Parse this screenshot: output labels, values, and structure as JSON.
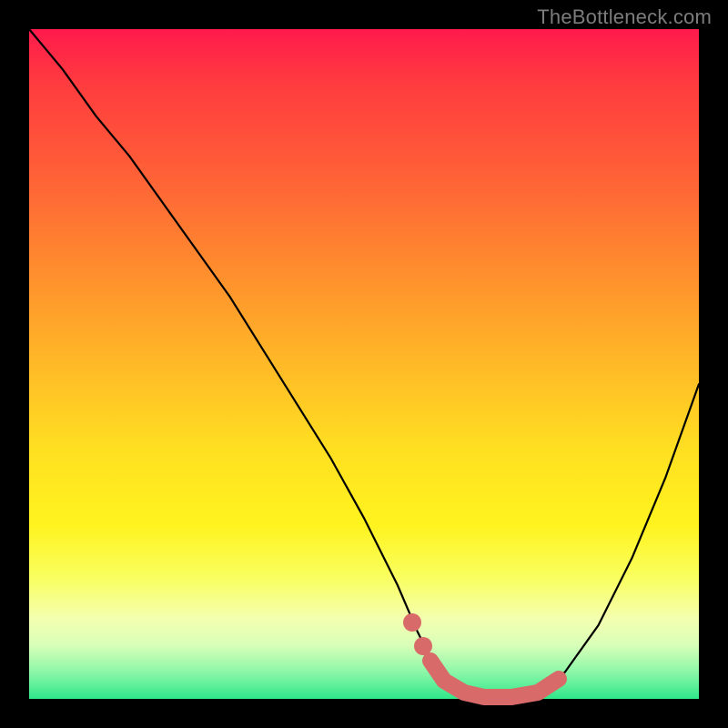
{
  "watermark": "TheBottleneck.com",
  "colors": {
    "background": "#000000",
    "curve": "#000000",
    "highlight": "#d96a6a",
    "gradient_top": "#ff1a4d",
    "gradient_bottom": "#2fe78a"
  },
  "chart_data": {
    "type": "line",
    "title": "",
    "xlabel": "",
    "ylabel": "",
    "xlim": [
      0,
      100
    ],
    "ylim": [
      0,
      100
    ],
    "grid": false,
    "legend": false,
    "series": [
      {
        "name": "bottleneck-curve",
        "x": [
          0,
          5,
          10,
          15,
          20,
          25,
          30,
          35,
          40,
          45,
          50,
          55,
          58,
          60,
          62,
          65,
          68,
          72,
          76,
          80,
          85,
          90,
          95,
          100
        ],
        "y": [
          100,
          94,
          87,
          81,
          74,
          67,
          60,
          52,
          44,
          36,
          27,
          17,
          10,
          6,
          3,
          1,
          0,
          0,
          1,
          4,
          11,
          21,
          33,
          47
        ]
      }
    ],
    "highlight_region": {
      "name": "optimal-zone",
      "x": [
        58,
        60,
        62,
        65,
        68,
        72,
        76,
        79
      ],
      "y": [
        10,
        5,
        2,
        0,
        0,
        0,
        1,
        3
      ]
    },
    "annotations": []
  }
}
